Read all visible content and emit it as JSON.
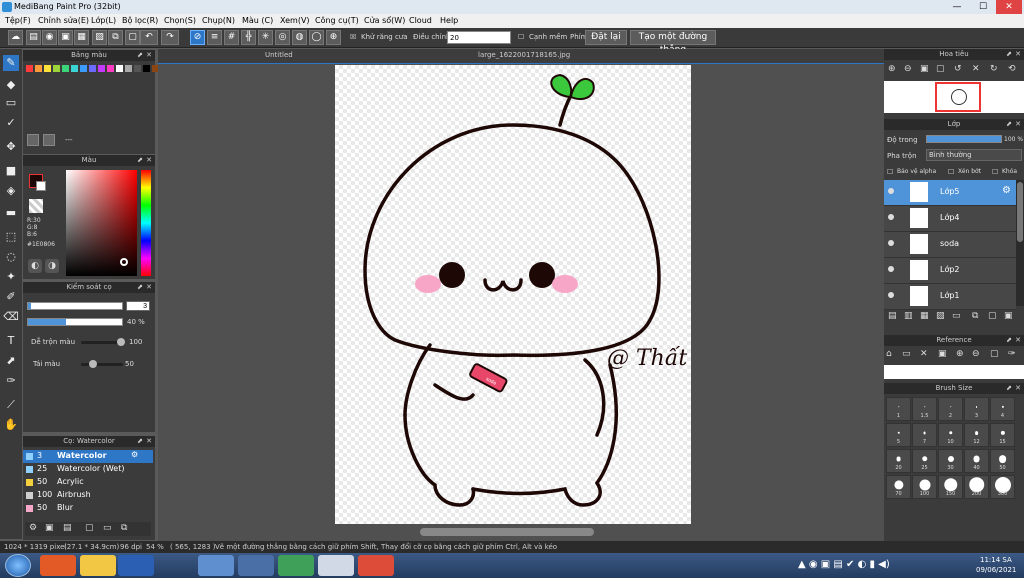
{
  "app": {
    "title": "MediBang Paint Pro (32bit)"
  },
  "window_controls": {
    "minimize": "—",
    "maximize": "☐",
    "close": "✕"
  },
  "menu": [
    "Tệp(F)",
    "Chỉnh sửa(E)",
    "Lớp(L)",
    "Bộ lọc(R)",
    "Chọn(S)",
    "Chụp(N)",
    "Màu (C)",
    "Xem(V)",
    "Công cụ(T)",
    "Cửa sổ(W)",
    "Cloud",
    "Help"
  ],
  "toolbar": {
    "antialias_label": "Khử răng cưa",
    "correction_label": "Điều chỉnh",
    "correction_value": "20",
    "snap_label": "Cạnh mềm",
    "pen_label": "Phím",
    "reset_label": "Đặt lại",
    "make_line_label": "Tạo một đường thẳng"
  },
  "tabs": {
    "untitled": "Untitled",
    "file": "large_1622001718165.jpg"
  },
  "panels": {
    "palette": {
      "title": "Bảng màu",
      "footer": "---"
    },
    "color": {
      "title": "Màu",
      "r": "R:30",
      "g": "G:8",
      "b": "B:6",
      "hex": "#1E0806"
    },
    "brush_control": {
      "title": "Kiểm soát cọ",
      "size_value": "3",
      "opacity_value": "40 %",
      "blend_label": "Dễ trộn màu",
      "blend_value": "100",
      "redip_label": "Tái màu",
      "redip_value": "50"
    },
    "brush_list": {
      "title": "Cọ: Watercolor",
      "items": [
        {
          "size": "3",
          "name": "Watercolor",
          "color": "#8fd0ff",
          "selected": true
        },
        {
          "size": "25",
          "name": "Watercolor (Wet)",
          "color": "#8fd0ff",
          "selected": false
        },
        {
          "size": "50",
          "name": "Acrylic",
          "color": "#f4d03f",
          "selected": false
        },
        {
          "size": "100",
          "name": "Airbrush",
          "color": "#cfcfcf",
          "selected": false
        },
        {
          "size": "50",
          "name": "Blur",
          "color": "#f5a8c8",
          "selected": false
        }
      ]
    },
    "navigator": {
      "title": "Hoa tiêu"
    },
    "layer": {
      "title": "Lớp",
      "opacity_label": "Độ trong",
      "opacity_value": "100 %",
      "blend_label": "Pha trộn",
      "blend_value": "Bình thường",
      "protect_alpha": "Bảo vệ alpha",
      "clipping": "Xén bớt",
      "lock": "Khóa",
      "layers": [
        {
          "name": "Lớp5",
          "selected": true
        },
        {
          "name": "Lớp4",
          "selected": false
        },
        {
          "name": "soda",
          "selected": false
        },
        {
          "name": "Lớp2",
          "selected": false
        },
        {
          "name": "Lớp1",
          "selected": false
        }
      ]
    },
    "reference": {
      "title": "Reference"
    },
    "brush_size": {
      "title": "Brush Size",
      "sizes": [
        "1",
        "1.5",
        "2",
        "3",
        "4",
        "5",
        "7",
        "10",
        "12",
        "15",
        "20",
        "25",
        "30",
        "40",
        "50",
        "70",
        "100",
        "150",
        "200",
        "300"
      ]
    }
  },
  "canvas_art": {
    "signature": "@ Thất",
    "can_text": "soda"
  },
  "status": {
    "size": "1024 * 1319 pixel",
    "cm": "(27.1 * 34.9cm)",
    "dpi": "96 dpi",
    "zoom": "54 %",
    "coords": "( 565, 1283 )",
    "hint": "Vẽ một đường thẳng bằng cách giữ phím Shift, Thay đổi cỡ cọ bằng cách giữ phím Ctrl, Alt và kéo"
  },
  "taskbar": {
    "time": "11:14 SA",
    "date": "09/06/2021"
  },
  "colors": {
    "accent": "#2d77c6",
    "panel": "#3b3b3b",
    "ink": "#1e0806",
    "sprout": "#3cc83c",
    "blush": "#f7a6c8"
  }
}
